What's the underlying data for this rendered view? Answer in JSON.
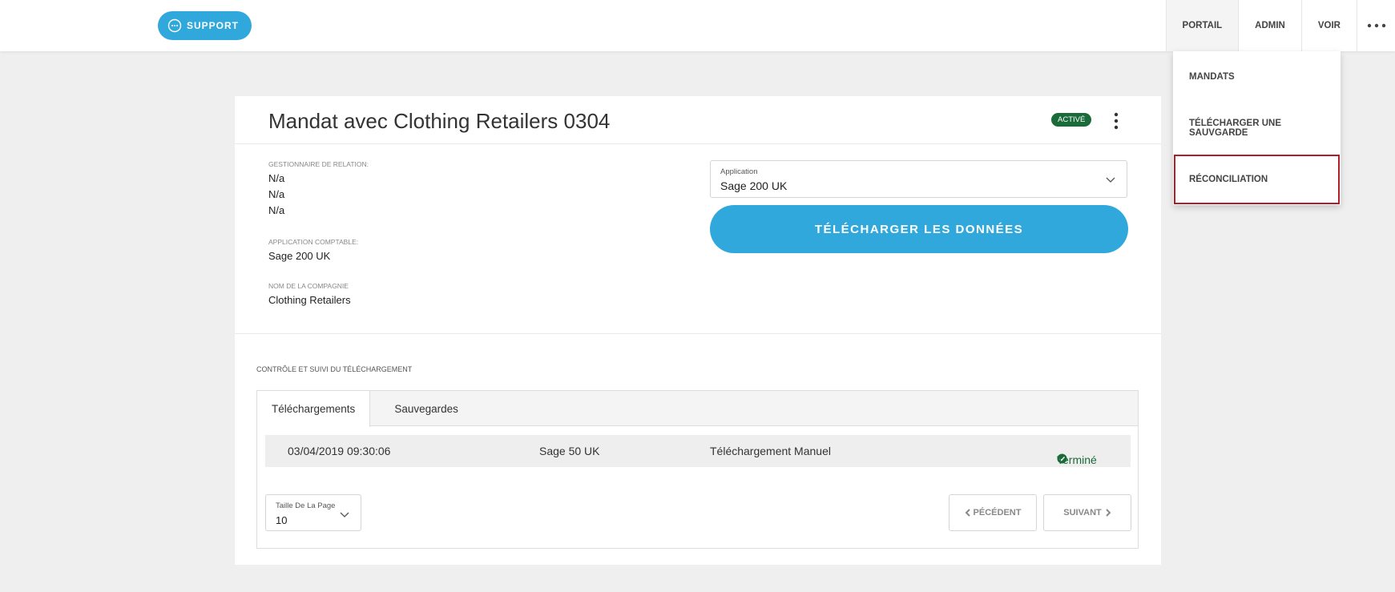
{
  "topbar": {
    "support_label": "SUPPORT",
    "nav": [
      {
        "label": "PORTAIL"
      },
      {
        "label": "ADMIN"
      },
      {
        "label": "VOIR"
      }
    ]
  },
  "dropdown": {
    "items": [
      {
        "label": "MANDATS"
      },
      {
        "label": "TÉLÉCHARGER UNE SAUVGARDE"
      },
      {
        "label": "RÉCONCILIATION"
      }
    ]
  },
  "card": {
    "title": "Mandat avec Clothing Retailers 0304",
    "status_badge": "ACTIVÉ",
    "relation_label": "GESTIONNAIRE DE RELATION:",
    "relation_values": [
      "N/a",
      "N/a",
      "N/a"
    ],
    "accounting_label": "APPLICATION COMPTABLE:",
    "accounting_value": "Sage 200 UK",
    "company_label": "NOM DE LA COMPAGNIE",
    "company_value": "Clothing Retailers",
    "application_select": {
      "label": "Application",
      "value": "Sage 200 UK"
    },
    "download_button": "TÉLÉCHARGER LES DONNÉES"
  },
  "tracking": {
    "section_label": "CONTRÔLE ET SUIVI DU TÉLÉCHARGEMENT",
    "tabs": [
      {
        "label": "Téléchargements"
      },
      {
        "label": "Sauvegardes"
      }
    ],
    "rows": [
      {
        "datetime": "03/04/2019 09:30:06",
        "application": "Sage 50 UK",
        "type": "Téléchargement Manuel",
        "status": "Terminé"
      }
    ],
    "page_size": {
      "label": "Taille De La Page",
      "value": "10"
    },
    "prev_label": "PÉCÉDENT",
    "next_label": "SUIVANT"
  },
  "colors": {
    "accent": "#31a8dc",
    "success": "#1a6a3a",
    "highlight": "#b11e2b"
  }
}
